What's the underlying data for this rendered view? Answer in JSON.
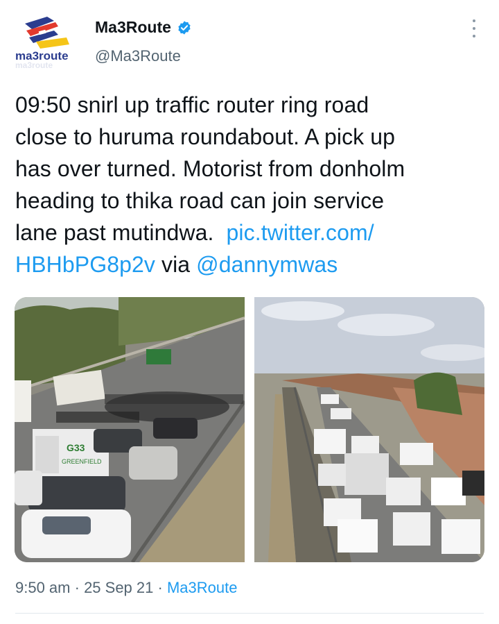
{
  "account": {
    "logo_text": "ma3route",
    "display_name": "Ma3Route",
    "handle": "@Ma3Route",
    "verified": true
  },
  "tweet": {
    "lines": [
      "09:50 snirl up traffic router ring road",
      "close to huruma roundabout. A pick up",
      "has over turned. Motorist from donholm",
      "heading to thika road can join service",
      "lane past mutindwa."
    ],
    "link_part1": "pic.twitter.com/",
    "link_part2": "HBHbPG8p2v",
    "via_text": " via ",
    "mention": "@dannymwas"
  },
  "media": {
    "photo1_label": "traffic-jam-overturned-pickup-photo",
    "photo1_truck_text": "GREENFIELD",
    "photo2_label": "ring-road-traffic-queue-photo"
  },
  "meta": {
    "time": "9:50 am",
    "sep1": " · ",
    "date": "25 Sep 21",
    "sep2": " · ",
    "source": "Ma3Route"
  },
  "colors": {
    "link": "#1d9bf0",
    "secondary_text": "#536471",
    "verified_badge": "#1d9bf0"
  }
}
